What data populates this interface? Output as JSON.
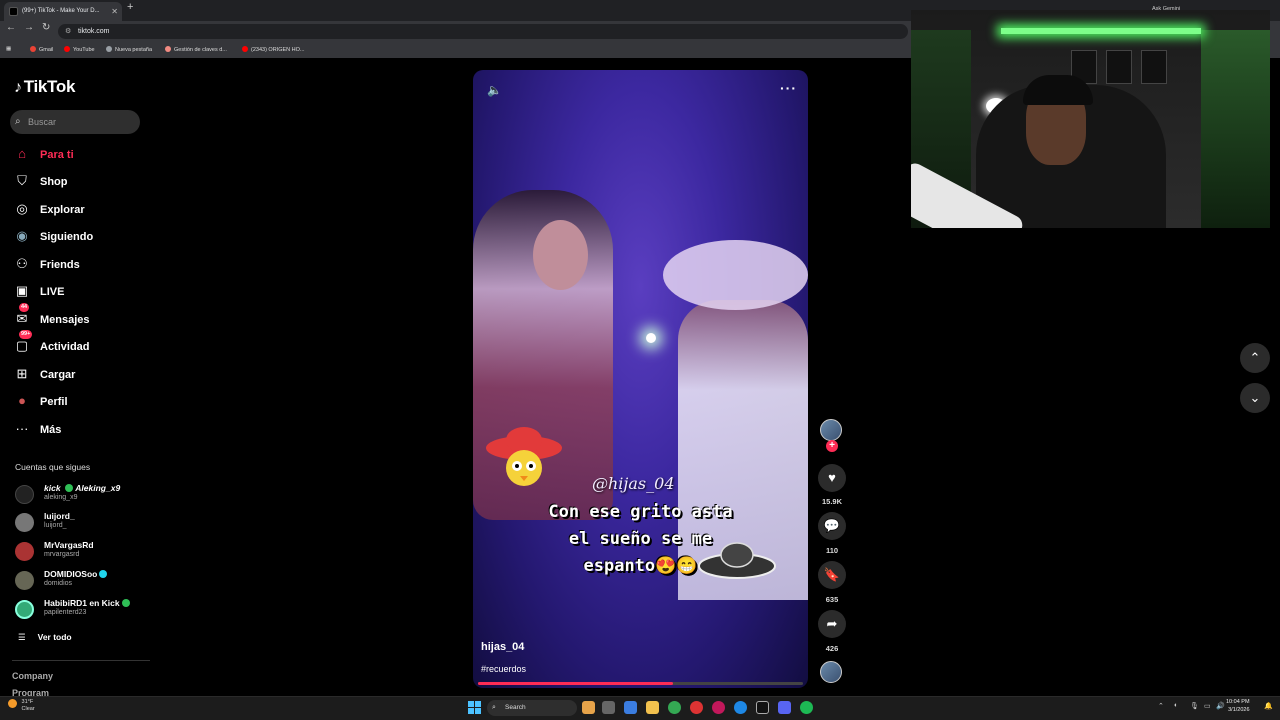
{
  "browser": {
    "tab_title": "(99+) TikTok - Make Your D...",
    "new_tab": "+",
    "url": "tiktok.com",
    "bookmarks": [
      {
        "label": "Gmail",
        "color": "#ea4335"
      },
      {
        "label": "YouTube",
        "color": "#ff0000"
      },
      {
        "label": "Nueva pestaña",
        "color": "#9aa0a6"
      },
      {
        "label": "Gestión de claves d...",
        "color": "#f28b82"
      },
      {
        "label": "(2343) ORIGEN HO...",
        "color": "#ff0000"
      }
    ]
  },
  "sidebar": {
    "logo": "TikTok",
    "search_placeholder": "Buscar",
    "nav": [
      {
        "label": "Para ti",
        "icon": "home-icon",
        "glyph": "⌂",
        "active": true
      },
      {
        "label": "Shop",
        "icon": "shop-icon",
        "glyph": "🛍",
        "active": false
      },
      {
        "label": "Explorar",
        "icon": "compass-icon",
        "glyph": "◎",
        "active": false
      },
      {
        "label": "Siguiendo",
        "icon": "following-avatar-icon",
        "glyph": "◉",
        "active": false
      },
      {
        "label": "Friends",
        "icon": "friends-icon",
        "glyph": "👥",
        "active": false
      },
      {
        "label": "LIVE",
        "icon": "live-icon",
        "glyph": "▣",
        "active": false
      },
      {
        "label": "Mensajes",
        "icon": "messages-icon",
        "glyph": "✉",
        "active": false,
        "badge": "44"
      },
      {
        "label": "Actividad",
        "icon": "activity-icon",
        "glyph": "▢",
        "active": false,
        "badge": "99+"
      },
      {
        "label": "Cargar",
        "icon": "upload-icon",
        "glyph": "⊞",
        "active": false
      },
      {
        "label": "Perfil",
        "icon": "profile-avatar-icon",
        "glyph": "●",
        "active": false
      },
      {
        "label": "Más",
        "icon": "more-dots-icon",
        "glyph": "···",
        "active": false
      }
    ],
    "following_heading": "Cuentas que sigues",
    "following": [
      {
        "name": "kick",
        "name2": "Aleking_x9",
        "handle": "aleking_x9",
        "verified": "green",
        "avatar_color": "#222"
      },
      {
        "name": "luijord_",
        "handle": "luijord_",
        "verified": "",
        "avatar_color": "#777"
      },
      {
        "name": "MrVargasRd",
        "handle": "mrvargasrd",
        "verified": "",
        "avatar_color": "#a33"
      },
      {
        "name": "DOMIDIOSoo",
        "handle": "domidios",
        "verified": "blue",
        "avatar_color": "#665"
      },
      {
        "name": "HabibiRD1 en Kick",
        "handle": "papilenterd23",
        "verified": "green",
        "avatar_color": "#3a7"
      }
    ],
    "see_all": "Ver todo",
    "footer": [
      "Company",
      "Program"
    ]
  },
  "video": {
    "overlay_handle": "@hijas_04",
    "caption_lines": [
      "Con ese grito asta",
      "el sueño se me",
      "espanto😍😁"
    ],
    "username": "hijas_04",
    "hashtag": "#recuerdos",
    "progress": 0.6
  },
  "actions": {
    "likes": "15.9K",
    "comments": "110",
    "saves": "635",
    "shares": "426"
  },
  "webcam": {
    "overlay_label": "Ask Gemini"
  },
  "taskbar": {
    "weather_temp": "31°F",
    "weather_desc": "Clear",
    "search_label": "Search",
    "time": "10:04 PM",
    "date": "3/1/2026"
  }
}
